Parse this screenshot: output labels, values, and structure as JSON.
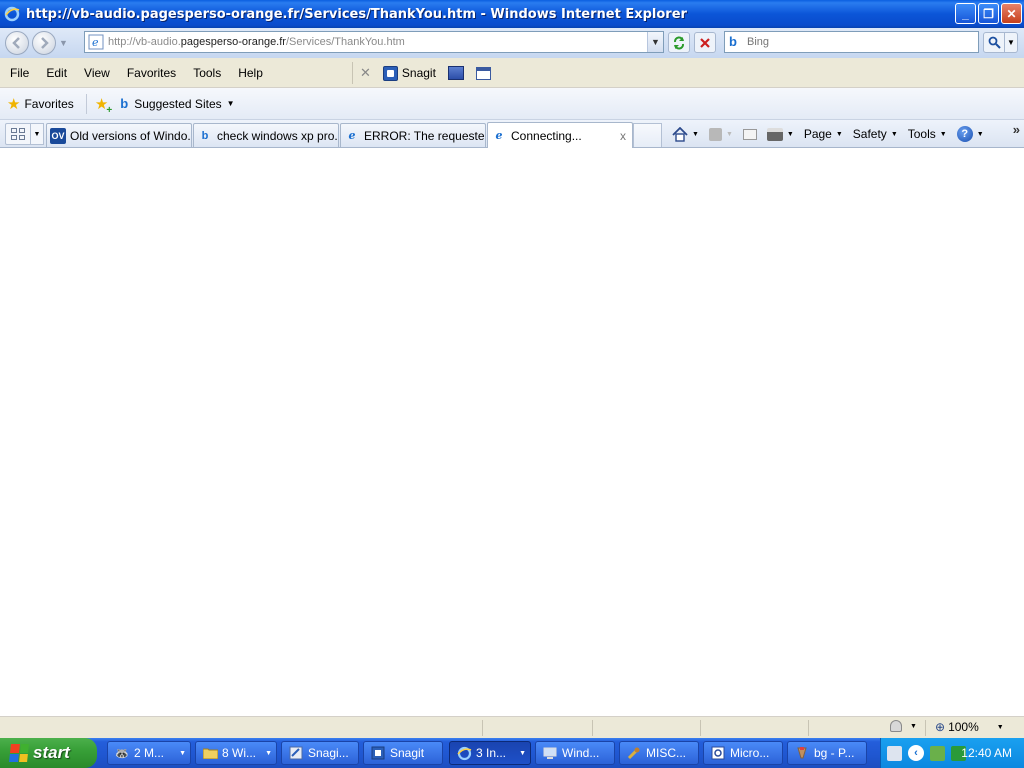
{
  "window": {
    "title": "http://vb-audio.pagesperso-orange.fr/Services/ThankYou.htm - Windows Internet Explorer",
    "minimize": "_",
    "restore": "❐",
    "close": "✕"
  },
  "address_bar": {
    "url_prefix": "http://vb-audio.",
    "url_domain": "pagesperso-orange.fr",
    "url_path": "/Services/ThankYou.htm"
  },
  "search": {
    "placeholder": "Bing",
    "provider_icon": "bing-icon"
  },
  "menu": {
    "items": [
      "File",
      "Edit",
      "View",
      "Favorites",
      "Tools",
      "Help"
    ]
  },
  "snagit_toolbar": {
    "label": "Snagit"
  },
  "favorites_bar": {
    "favorites_label": "Favorites",
    "suggested_sites_label": "Suggested Sites"
  },
  "tabs": [
    {
      "label": "Old versions of Windo...",
      "icon": "oldversion-icon",
      "icon_text": "OV"
    },
    {
      "label": "check windows xp pro...",
      "icon": "bing-icon",
      "icon_text": "b"
    },
    {
      "label": "ERROR: The requeste...",
      "icon": "ie-icon",
      "icon_text": "e"
    },
    {
      "label": "Connecting...",
      "icon": "ie-icon",
      "icon_text": "e",
      "active": true,
      "close": "x"
    }
  ],
  "command_bar": {
    "page": "Page",
    "safety": "Safety",
    "tools": "Tools",
    "help": "?"
  },
  "status_bar": {
    "zoom": "100%"
  },
  "taskbar": {
    "start_label": "start",
    "buttons": [
      {
        "label": "2 M...",
        "icon": "raccoon-icon"
      },
      {
        "label": "8 Wi...",
        "icon": "folder-icon"
      },
      {
        "label": "Snagi...",
        "icon": "snagit-editor-icon"
      },
      {
        "label": "Snagit",
        "icon": "snagit-icon"
      },
      {
        "label": "3 In...",
        "icon": "ie-icon",
        "active": true
      },
      {
        "label": "Wind...",
        "icon": "computer-icon"
      },
      {
        "label": "MISC...",
        "icon": "tools-icon"
      },
      {
        "label": "Micro...",
        "icon": "msword-icon"
      },
      {
        "label": "bg - P...",
        "icon": "paint-icon"
      }
    ],
    "clock": "12:40 AM"
  }
}
